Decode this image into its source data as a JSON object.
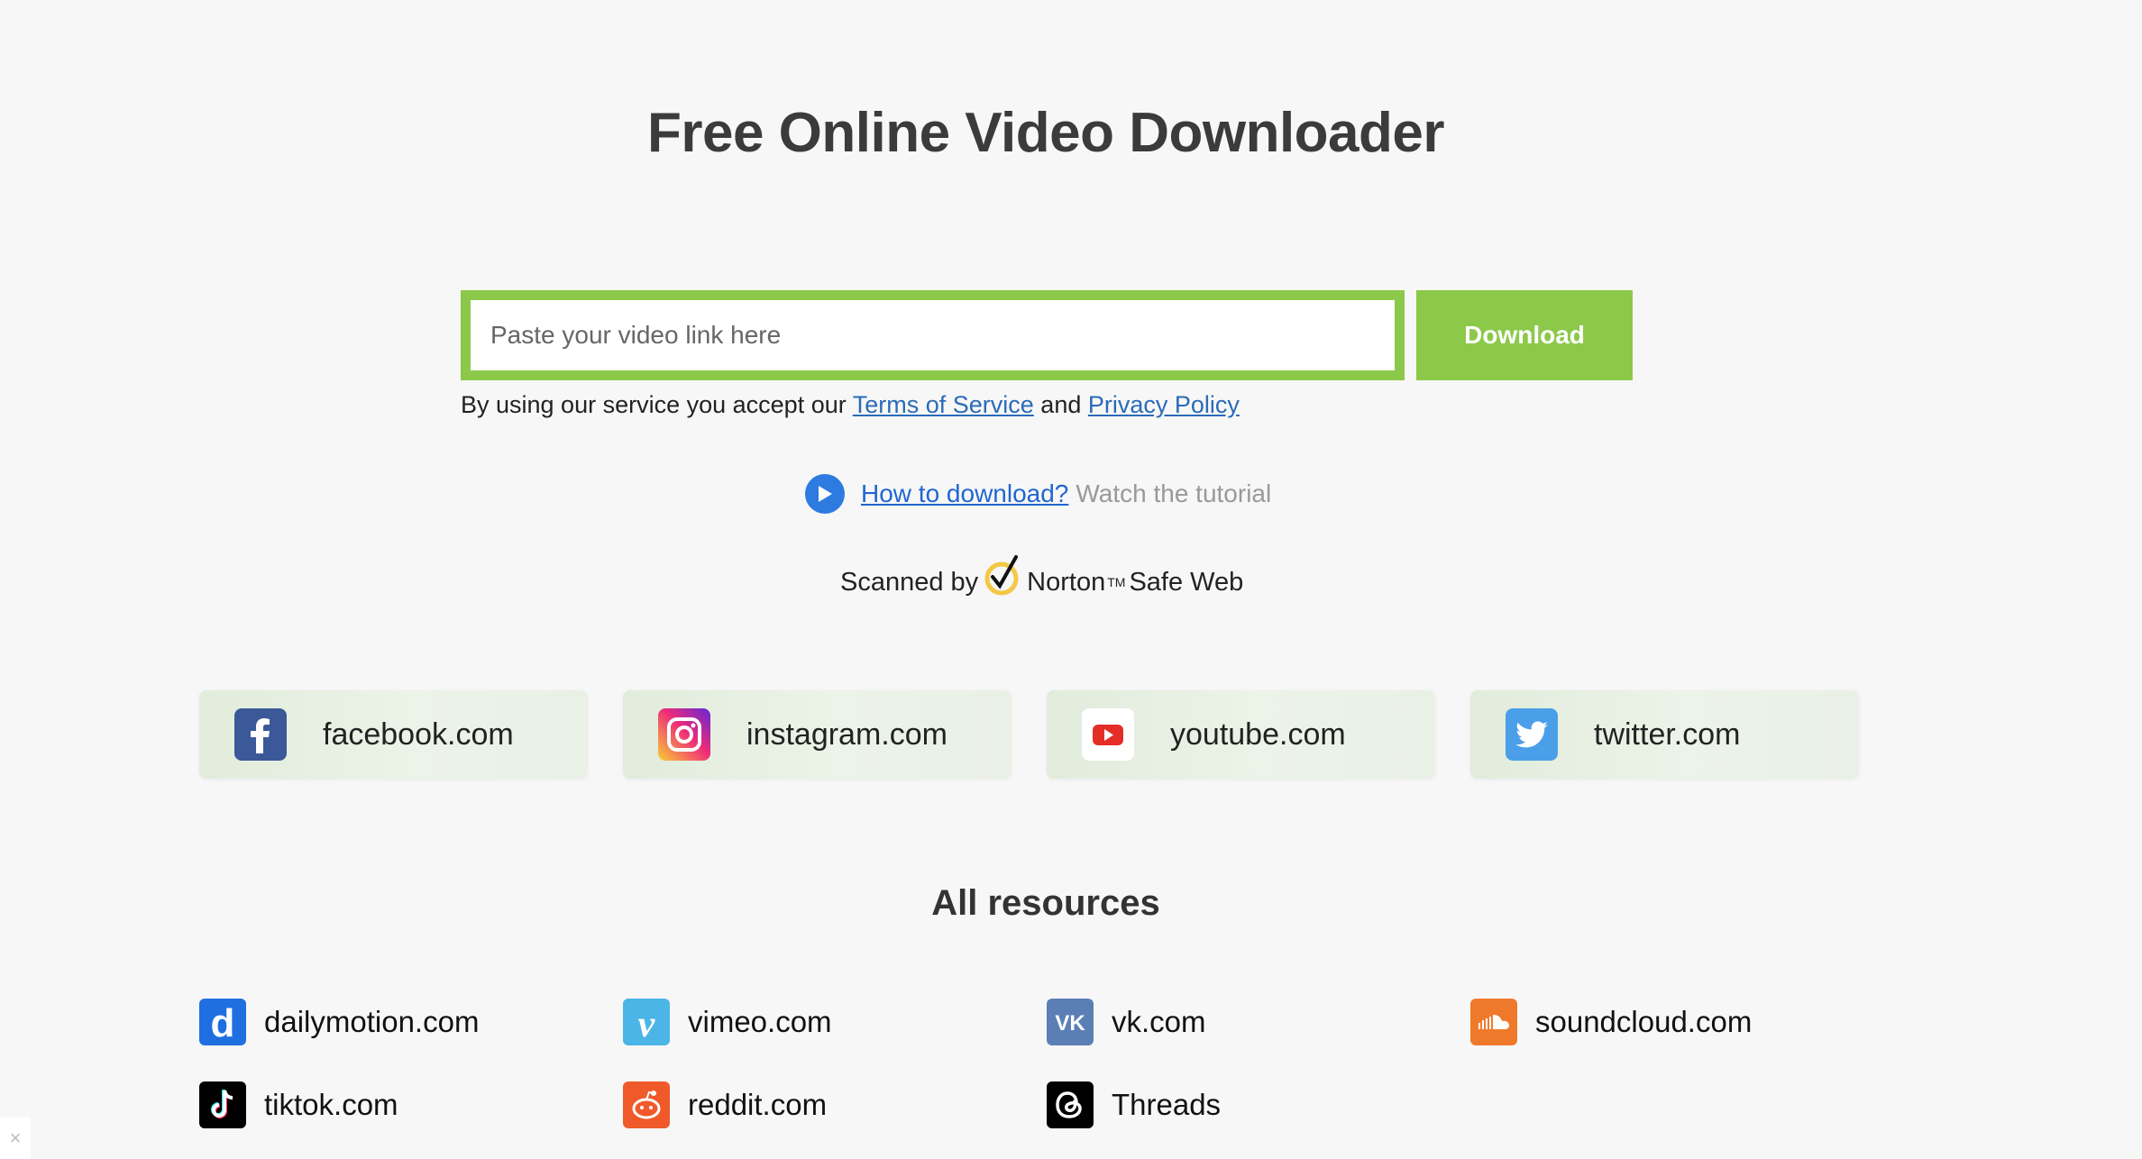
{
  "header": {
    "title": "Free Online Video Downloader"
  },
  "search": {
    "placeholder": "Paste your video link here",
    "value": ""
  },
  "download_button": {
    "label": "Download"
  },
  "terms": {
    "prefix": "By using our service you accept our ",
    "terms_link": "Terms of Service",
    "middle": " and ",
    "privacy_link": "Privacy Policy"
  },
  "tutorial": {
    "link": "How to download?",
    "suffix": "Watch the tutorial"
  },
  "norton": {
    "prefix": "Scanned by",
    "brand": "Norton",
    "tm": "TM",
    "suffix": "Safe Web"
  },
  "featured": [
    {
      "label": "facebook.com",
      "icon": "facebook-icon",
      "color": "#3b5998"
    },
    {
      "label": "instagram.com",
      "icon": "instagram-icon",
      "color": "#d6249f"
    },
    {
      "label": "youtube.com",
      "icon": "youtube-icon",
      "color": "#e52d27"
    },
    {
      "label": "twitter.com",
      "icon": "twitter-icon",
      "color": "#4a9fe8"
    }
  ],
  "resources_title": "All resources",
  "resources": [
    {
      "label": "dailymotion.com",
      "icon": "dailymotion-icon",
      "color": "#1f6fe0"
    },
    {
      "label": "vimeo.com",
      "icon": "vimeo-icon",
      "color": "#4bb5e8"
    },
    {
      "label": "vk.com",
      "icon": "vk-icon",
      "color": "#5b7fb5"
    },
    {
      "label": "soundcloud.com",
      "icon": "soundcloud-icon",
      "color": "#f07a2c"
    },
    {
      "label": "tiktok.com",
      "icon": "tiktok-icon",
      "color": "#000000"
    },
    {
      "label": "reddit.com",
      "icon": "reddit-icon",
      "color": "#f05a2a"
    },
    {
      "label": "Threads",
      "icon": "threads-icon",
      "color": "#000000"
    }
  ],
  "accent_color": "#8cc94a"
}
